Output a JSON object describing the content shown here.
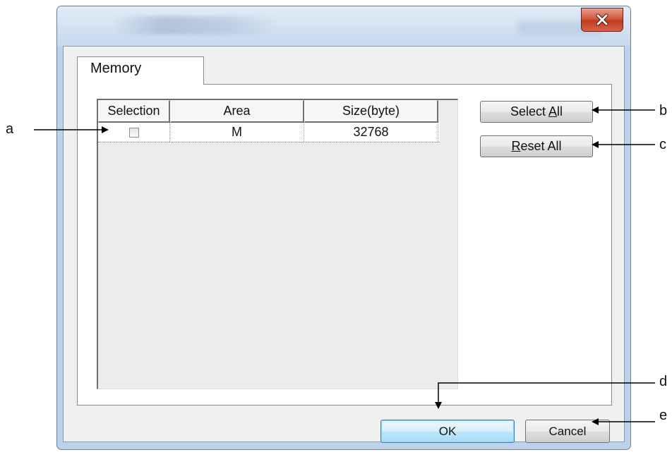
{
  "window": {
    "close_icon": "close-icon"
  },
  "tabs": [
    {
      "label": "Memory"
    }
  ],
  "grid": {
    "columns": [
      "Selection",
      "Area",
      "Size(byte)"
    ],
    "rows": [
      {
        "selected": false,
        "area": "M",
        "size": "32768"
      }
    ]
  },
  "buttons": {
    "select_all": {
      "label": "Select ",
      "mnemonic": "A",
      "rest": "ll"
    },
    "reset_all": {
      "label": "",
      "mnemonic": "R",
      "rest": "eset All"
    },
    "ok": "OK",
    "cancel": "Cancel"
  },
  "annotations": {
    "a": "a",
    "b": "b",
    "c": "c",
    "d": "d",
    "e": "e"
  },
  "colors": {
    "close_button": "#c13a1d",
    "ok_button_border": "#3c7fb1"
  }
}
